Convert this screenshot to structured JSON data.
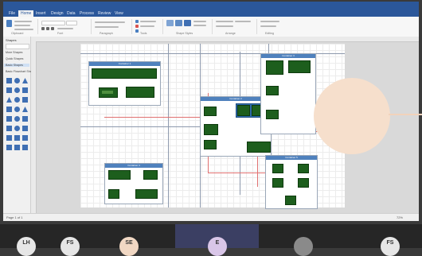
{
  "ribbon": {
    "tabs": [
      "File",
      "Home",
      "Insert",
      "Design",
      "Data",
      "Process",
      "Review",
      "View"
    ],
    "active_tab": "Home",
    "groups": [
      "Clipboard",
      "Font",
      "Paragraph",
      "Tools",
      "Shape Styles",
      "Arrange",
      "Editing"
    ]
  },
  "sidebar": {
    "title": "Shapes",
    "items": [
      "More Shapes",
      "Quick Shapes",
      "Basic Shapes",
      "Basic Flowchart Shapes"
    ],
    "selected_index": 2
  },
  "status": {
    "page": "Page 1 of 1",
    "zoom": "72%"
  },
  "diagram": {
    "containers": [
      "Container 1",
      "Container 2",
      "Container 3",
      "Container 4",
      "Container 5"
    ]
  },
  "participants": [
    {
      "initials": "LH",
      "color": "#e6e6e6"
    },
    {
      "initials": "FS",
      "color": "#e6e6e6"
    },
    {
      "initials": "SE",
      "color": "#f1d8c4"
    },
    {
      "initials": "E",
      "color": "#d9c6e8",
      "active": true
    },
    {
      "initials": "",
      "color": "#8a8a8a"
    },
    {
      "initials": "FS",
      "color": "#e6e6e6"
    }
  ]
}
